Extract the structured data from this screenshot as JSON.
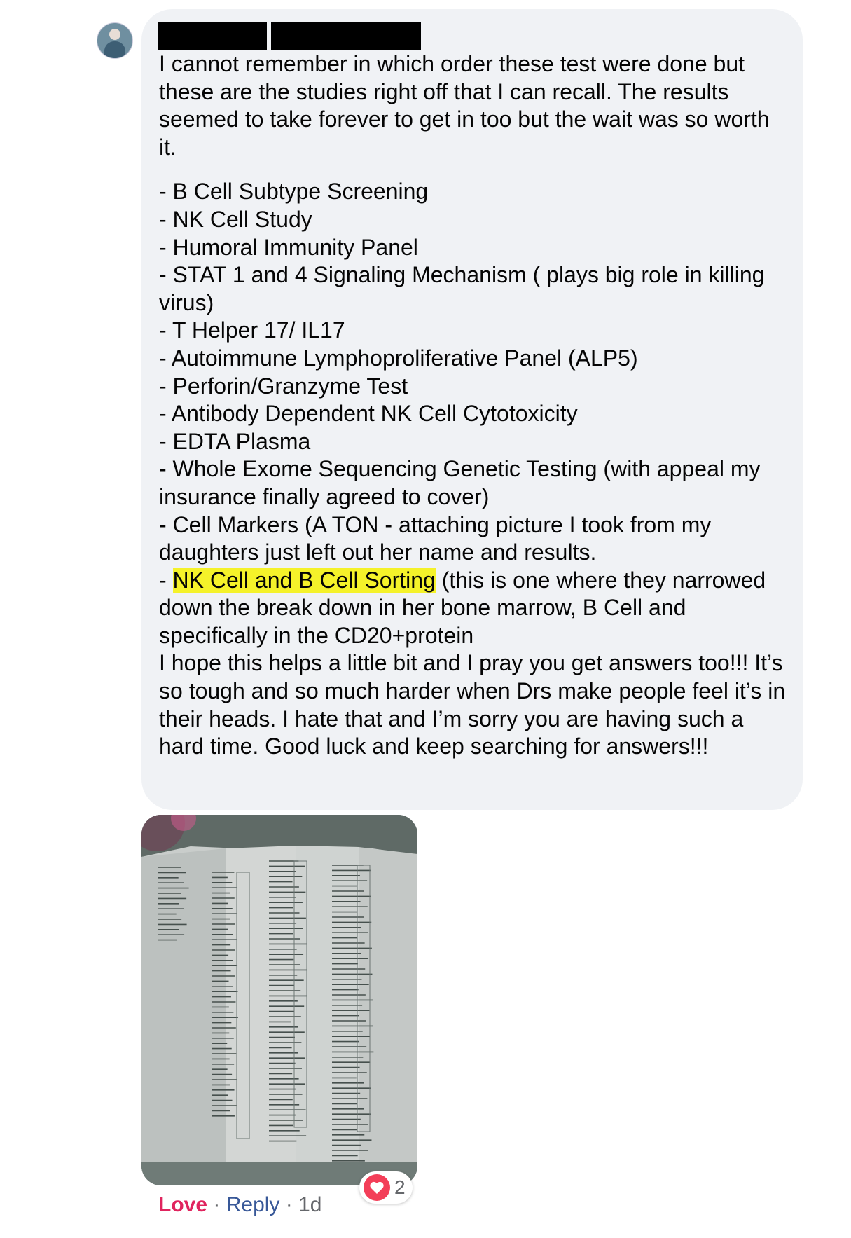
{
  "colors": {
    "bubble_bg": "#f0f2f5",
    "text": "#050505",
    "highlight": "#f5f22a",
    "love": "#e0245e",
    "link": "#385898",
    "meta": "#65676b",
    "heart_badge": "#f33e58"
  },
  "comment": {
    "author_redacted": true,
    "intro": "I cannot remember in which order these test were done but these are the studies right off that I can recall. The results seemed to take forever to get in too but the wait was so worth it.",
    "items": [
      "- B Cell Subtype Screening",
      "- NK Cell Study",
      "- Humoral Immunity Panel",
      "- STAT 1 and 4 Signaling Mechanism ( plays big role in killing virus)",
      "- T Helper 17/ IL17",
      "- Autoimmune Lymphoproliferative Panel (ALP5)",
      "- Perforin/Granzyme Test",
      "- Antibody Dependent NK Cell Cytotoxicity",
      "- EDTA Plasma",
      "- Whole Exome Sequencing Genetic Testing (with appeal my insurance finally agreed to cover)",
      "- Cell Markers (A TON - attaching picture I took from my daughters just left out her name and results."
    ],
    "highlight_item": {
      "prefix": "- ",
      "highlighted": "NK Cell and B Cell Sorting",
      "rest": " (this is one where they narrowed down the break down in her bone marrow, B Cell and specifically in the CD20+protein"
    },
    "closing": "I hope this helps a little bit and I pray you get answers too!!! It’s so tough and so much harder when Drs make people feel it’s in their heads. I hate that and I’m sorry you are having such a hard time. Good luck and keep searching for answers!!!"
  },
  "attachment": {
    "icon": "photo-of-lab-result-sheets"
  },
  "actions": {
    "love": "Love",
    "separator": "·",
    "reply": "Reply",
    "time": "1d"
  },
  "reactions": {
    "icon": "heart-icon",
    "count": "2"
  }
}
